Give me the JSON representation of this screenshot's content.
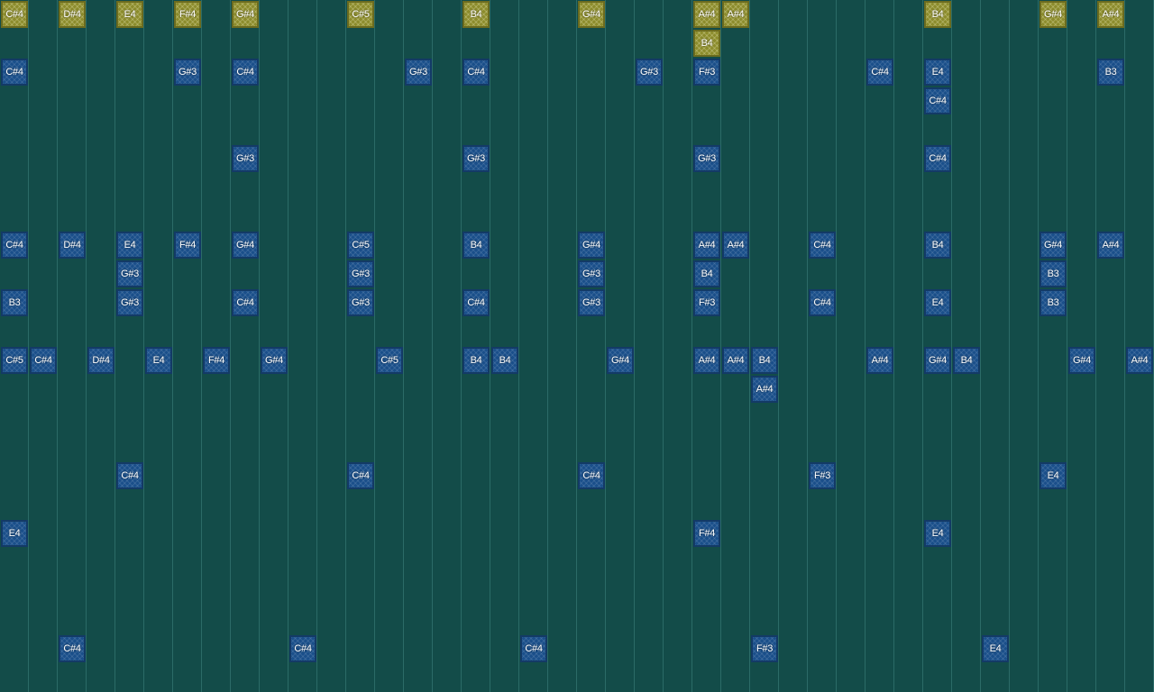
{
  "colors": {
    "background": "#134c49",
    "lane_line": "#2b6b67",
    "note_blue": "#1a4f8a",
    "note_gold": "#8c8c2c",
    "label": "#ffffff"
  },
  "lanes": 40,
  "rows": 24,
  "notes": [
    {
      "label": "C#4",
      "lane": 0,
      "row": 0,
      "kind": "gold"
    },
    {
      "label": "D#4",
      "lane": 2,
      "row": 0,
      "kind": "gold"
    },
    {
      "label": "E4",
      "lane": 4,
      "row": 0,
      "kind": "gold"
    },
    {
      "label": "F#4",
      "lane": 6,
      "row": 0,
      "kind": "gold"
    },
    {
      "label": "G#4",
      "lane": 8,
      "row": 0,
      "kind": "gold"
    },
    {
      "label": "C#5",
      "lane": 12,
      "row": 0,
      "kind": "gold"
    },
    {
      "label": "B4",
      "lane": 16,
      "row": 0,
      "kind": "gold"
    },
    {
      "label": "G#4",
      "lane": 20,
      "row": 0,
      "kind": "gold"
    },
    {
      "label": "A#4",
      "lane": 24,
      "row": 0,
      "kind": "gold"
    },
    {
      "label": "A#4",
      "lane": 25,
      "row": 0,
      "kind": "gold"
    },
    {
      "label": "B4",
      "lane": 32,
      "row": 0,
      "kind": "gold"
    },
    {
      "label": "G#4",
      "lane": 36,
      "row": 0,
      "kind": "gold"
    },
    {
      "label": "A#4",
      "lane": 38,
      "row": 0,
      "kind": "gold"
    },
    {
      "label": "B4",
      "lane": 24,
      "row": 1,
      "kind": "gold"
    },
    {
      "label": "C#4",
      "lane": 0,
      "row": 2,
      "kind": "blue"
    },
    {
      "label": "G#3",
      "lane": 6,
      "row": 2,
      "kind": "blue"
    },
    {
      "label": "C#4",
      "lane": 8,
      "row": 2,
      "kind": "blue"
    },
    {
      "label": "G#3",
      "lane": 14,
      "row": 2,
      "kind": "blue"
    },
    {
      "label": "C#4",
      "lane": 16,
      "row": 2,
      "kind": "blue"
    },
    {
      "label": "G#3",
      "lane": 22,
      "row": 2,
      "kind": "blue"
    },
    {
      "label": "F#3",
      "lane": 24,
      "row": 2,
      "kind": "blue"
    },
    {
      "label": "C#4",
      "lane": 30,
      "row": 2,
      "kind": "blue"
    },
    {
      "label": "E4",
      "lane": 32,
      "row": 2,
      "kind": "blue"
    },
    {
      "label": "B3",
      "lane": 38,
      "row": 2,
      "kind": "blue"
    },
    {
      "label": "C#4",
      "lane": 32,
      "row": 3,
      "kind": "blue"
    },
    {
      "label": "G#3",
      "lane": 8,
      "row": 5,
      "kind": "blue"
    },
    {
      "label": "G#3",
      "lane": 16,
      "row": 5,
      "kind": "blue"
    },
    {
      "label": "G#3",
      "lane": 24,
      "row": 5,
      "kind": "blue"
    },
    {
      "label": "C#4",
      "lane": 32,
      "row": 5,
      "kind": "blue"
    },
    {
      "label": "C#4",
      "lane": 0,
      "row": 8,
      "kind": "blue"
    },
    {
      "label": "D#4",
      "lane": 2,
      "row": 8,
      "kind": "blue"
    },
    {
      "label": "E4",
      "lane": 4,
      "row": 8,
      "kind": "blue"
    },
    {
      "label": "F#4",
      "lane": 6,
      "row": 8,
      "kind": "blue"
    },
    {
      "label": "G#4",
      "lane": 8,
      "row": 8,
      "kind": "blue"
    },
    {
      "label": "C#5",
      "lane": 12,
      "row": 8,
      "kind": "blue"
    },
    {
      "label": "B4",
      "lane": 16,
      "row": 8,
      "kind": "blue"
    },
    {
      "label": "G#4",
      "lane": 20,
      "row": 8,
      "kind": "blue"
    },
    {
      "label": "A#4",
      "lane": 24,
      "row": 8,
      "kind": "blue"
    },
    {
      "label": "A#4",
      "lane": 25,
      "row": 8,
      "kind": "blue"
    },
    {
      "label": "C#4",
      "lane": 28,
      "row": 8,
      "kind": "blue"
    },
    {
      "label": "B4",
      "lane": 32,
      "row": 8,
      "kind": "blue"
    },
    {
      "label": "G#4",
      "lane": 36,
      "row": 8,
      "kind": "blue"
    },
    {
      "label": "A#4",
      "lane": 38,
      "row": 8,
      "kind": "blue"
    },
    {
      "label": "G#3",
      "lane": 4,
      "row": 9,
      "kind": "blue"
    },
    {
      "label": "G#3",
      "lane": 12,
      "row": 9,
      "kind": "blue"
    },
    {
      "label": "G#3",
      "lane": 20,
      "row": 9,
      "kind": "blue"
    },
    {
      "label": "B4",
      "lane": 24,
      "row": 9,
      "kind": "blue"
    },
    {
      "label": "B3",
      "lane": 36,
      "row": 9,
      "kind": "blue"
    },
    {
      "label": "B3",
      "lane": 0,
      "row": 10,
      "kind": "blue"
    },
    {
      "label": "G#3",
      "lane": 4,
      "row": 10,
      "kind": "blue"
    },
    {
      "label": "C#4",
      "lane": 8,
      "row": 10,
      "kind": "blue"
    },
    {
      "label": "G#3",
      "lane": 12,
      "row": 10,
      "kind": "blue"
    },
    {
      "label": "C#4",
      "lane": 16,
      "row": 10,
      "kind": "blue"
    },
    {
      "label": "G#3",
      "lane": 20,
      "row": 10,
      "kind": "blue"
    },
    {
      "label": "F#3",
      "lane": 24,
      "row": 10,
      "kind": "blue"
    },
    {
      "label": "C#4",
      "lane": 28,
      "row": 10,
      "kind": "blue"
    },
    {
      "label": "E4",
      "lane": 32,
      "row": 10,
      "kind": "blue"
    },
    {
      "label": "B3",
      "lane": 36,
      "row": 10,
      "kind": "blue"
    },
    {
      "label": "C#5",
      "lane": 0,
      "row": 12,
      "kind": "blue"
    },
    {
      "label": "C#4",
      "lane": 1,
      "row": 12,
      "kind": "blue"
    },
    {
      "label": "D#4",
      "lane": 3,
      "row": 12,
      "kind": "blue"
    },
    {
      "label": "E4",
      "lane": 5,
      "row": 12,
      "kind": "blue"
    },
    {
      "label": "F#4",
      "lane": 7,
      "row": 12,
      "kind": "blue"
    },
    {
      "label": "G#4",
      "lane": 9,
      "row": 12,
      "kind": "blue"
    },
    {
      "label": "C#5",
      "lane": 13,
      "row": 12,
      "kind": "blue"
    },
    {
      "label": "B4",
      "lane": 16,
      "row": 12,
      "kind": "blue"
    },
    {
      "label": "B4",
      "lane": 17,
      "row": 12,
      "kind": "blue"
    },
    {
      "label": "G#4",
      "lane": 21,
      "row": 12,
      "kind": "blue"
    },
    {
      "label": "A#4",
      "lane": 24,
      "row": 12,
      "kind": "blue"
    },
    {
      "label": "A#4",
      "lane": 25,
      "row": 12,
      "kind": "blue"
    },
    {
      "label": "B4",
      "lane": 26,
      "row": 12,
      "kind": "blue"
    },
    {
      "label": "A#4",
      "lane": 30,
      "row": 12,
      "kind": "blue"
    },
    {
      "label": "G#4",
      "lane": 32,
      "row": 12,
      "kind": "blue"
    },
    {
      "label": "B4",
      "lane": 33,
      "row": 12,
      "kind": "blue"
    },
    {
      "label": "G#4",
      "lane": 37,
      "row": 12,
      "kind": "blue"
    },
    {
      "label": "A#4",
      "lane": 39,
      "row": 12,
      "kind": "blue"
    },
    {
      "label": "A#4",
      "lane": 26,
      "row": 13,
      "kind": "blue"
    },
    {
      "label": "C#4",
      "lane": 4,
      "row": 16,
      "kind": "blue"
    },
    {
      "label": "C#4",
      "lane": 12,
      "row": 16,
      "kind": "blue"
    },
    {
      "label": "C#4",
      "lane": 20,
      "row": 16,
      "kind": "blue"
    },
    {
      "label": "F#3",
      "lane": 28,
      "row": 16,
      "kind": "blue"
    },
    {
      "label": "E4",
      "lane": 36,
      "row": 16,
      "kind": "blue"
    },
    {
      "label": "E4",
      "lane": 0,
      "row": 18,
      "kind": "blue"
    },
    {
      "label": "F#4",
      "lane": 24,
      "row": 18,
      "kind": "blue"
    },
    {
      "label": "E4",
      "lane": 32,
      "row": 18,
      "kind": "blue"
    },
    {
      "label": "C#4",
      "lane": 2,
      "row": 22,
      "kind": "blue"
    },
    {
      "label": "C#4",
      "lane": 10,
      "row": 22,
      "kind": "blue"
    },
    {
      "label": "C#4",
      "lane": 18,
      "row": 22,
      "kind": "blue"
    },
    {
      "label": "F#3",
      "lane": 26,
      "row": 22,
      "kind": "blue"
    },
    {
      "label": "E4",
      "lane": 34,
      "row": 22,
      "kind": "blue"
    }
  ]
}
